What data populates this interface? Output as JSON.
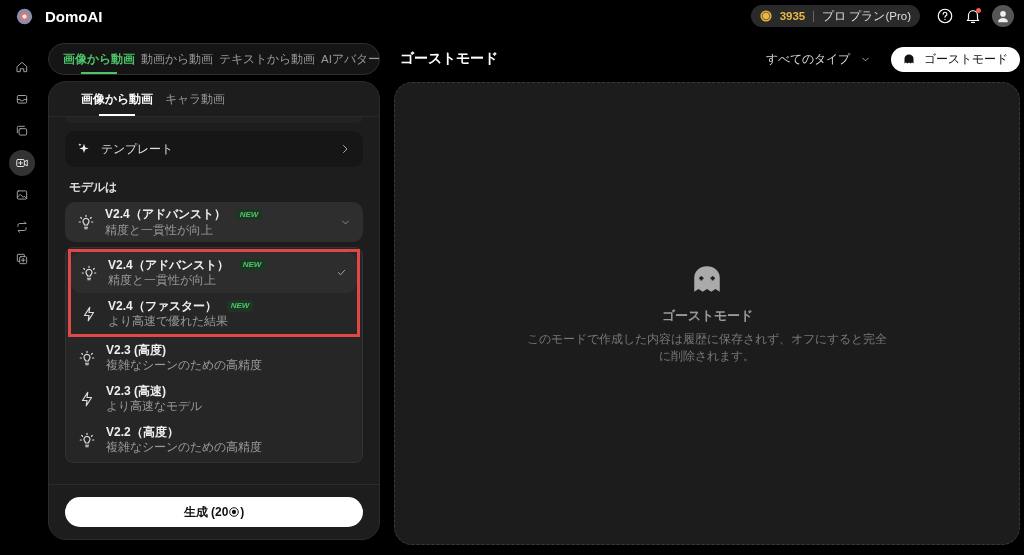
{
  "header": {
    "brand": "DomoAI",
    "credits": "3935",
    "plan": "プロ プラン(Pro)",
    "notification_dot": true
  },
  "sidebar": {
    "items": [
      {
        "kind": "home",
        "selected": false
      },
      {
        "kind": "inbox",
        "selected": false
      },
      {
        "kind": "layers",
        "selected": false
      },
      {
        "kind": "video",
        "selected": true
      },
      {
        "kind": "image",
        "selected": false
      },
      {
        "kind": "repeat",
        "selected": false
      },
      {
        "kind": "copy",
        "selected": false
      }
    ]
  },
  "mode_tabs": [
    {
      "label": "画像から動画",
      "selected": true
    },
    {
      "label": "動画から動画",
      "selected": false
    },
    {
      "label": "テキストから動画",
      "selected": false
    },
    {
      "label": "AIアバター",
      "selected": false
    }
  ],
  "sub_tabs": [
    {
      "label": "画像から動画",
      "selected": true
    },
    {
      "label": "キャラ動画",
      "selected": false
    }
  ],
  "template_row": {
    "label": "テンプレート"
  },
  "model": {
    "label": "モデルは",
    "current": {
      "kind": "bulb",
      "title": "V2.4（アドバンスト）",
      "badge": "NEW",
      "subtitle": "精度と一貫性が向上"
    },
    "options": [
      {
        "kind": "bulb",
        "title": "V2.4（アドバンスト）",
        "badge": "NEW",
        "subtitle": "精度と一貫性が向上",
        "selected": true,
        "highlighted": true
      },
      {
        "kind": "bolt",
        "title": "V2.4（ファスター）",
        "badge": "NEW",
        "subtitle": "より高速で優れた結果",
        "selected": false,
        "highlighted": true
      },
      {
        "kind": "bulb",
        "title": "V2.3 (高度)",
        "subtitle": "複雑なシーンのための高精度",
        "selected": false,
        "highlighted": false
      },
      {
        "kind": "bolt",
        "title": "V2.3 (高速)",
        "subtitle": "より高速なモデル",
        "selected": false,
        "highlighted": false
      },
      {
        "kind": "bulb",
        "title": "V2.2（高度）",
        "subtitle": "複雑なシーンのための高精度",
        "selected": false,
        "highlighted": false
      }
    ]
  },
  "generate_button": {
    "label": "生成 (20",
    "suffix": ")"
  },
  "ghost": {
    "title": "ゴーストモード",
    "filter": "すべてのタイプ",
    "toggle_label": "ゴーストモード",
    "empty_title": "ゴーストモード",
    "empty_text": "このモードで作成した内容は履歴に保存されず、オフにすると完全に削除されます。"
  }
}
